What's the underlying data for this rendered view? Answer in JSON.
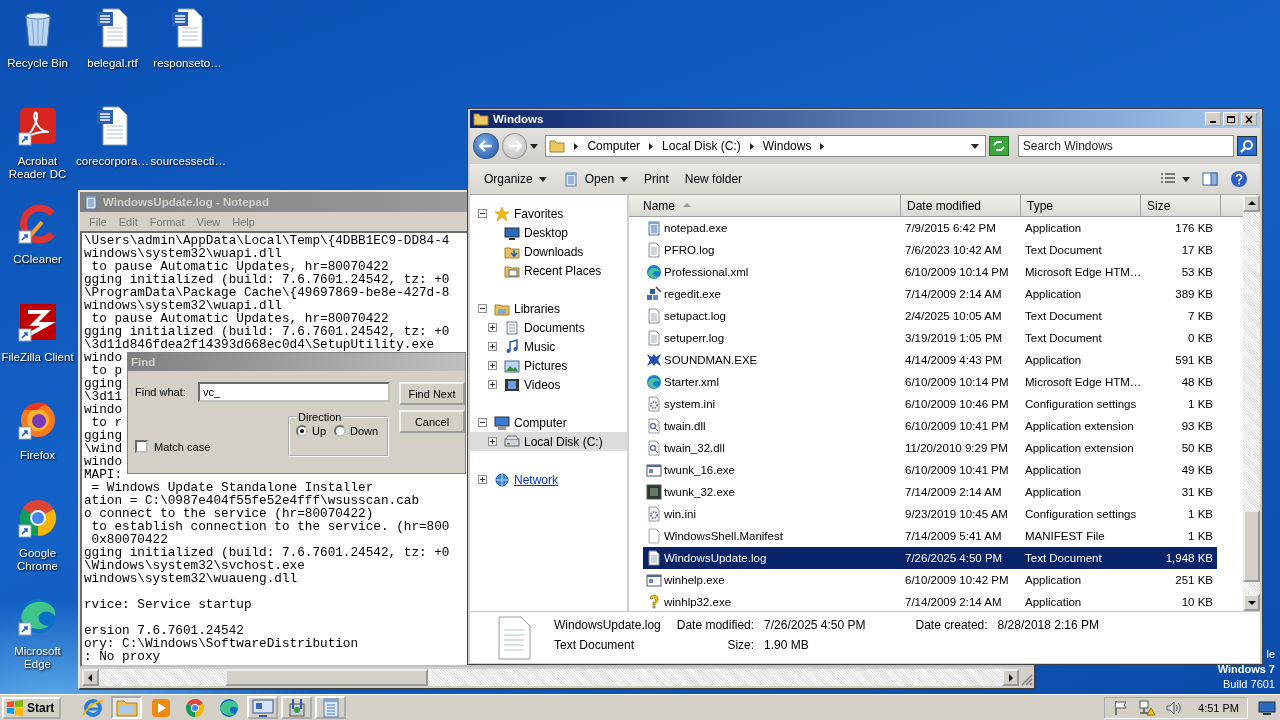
{
  "desktop": {
    "columns": [
      [
        {
          "label": "Recycle Bin",
          "kind": "recycle"
        },
        {
          "label": "Acrobat Reader DC",
          "kind": "pdf",
          "shortcut": true
        },
        {
          "label": "CCleaner",
          "kind": "cleaner",
          "shortcut": true
        },
        {
          "label": "FileZilla Client",
          "kind": "ftp",
          "shortcut": true
        },
        {
          "label": "Firefox",
          "kind": "firefox",
          "shortcut": true
        },
        {
          "label": "Google Chrome",
          "kind": "chrome",
          "shortcut": true
        },
        {
          "label": "Microsoft Edge",
          "kind": "edge",
          "shortcut": true
        }
      ],
      [
        {
          "label": "belegal.rtf",
          "kind": "word"
        },
        {
          "label": "corecorpora…",
          "kind": "word"
        }
      ],
      [
        {
          "label": "responseto…",
          "kind": "word"
        },
        {
          "label": "sourcessecti…",
          "kind": "blank"
        }
      ]
    ],
    "notice": [
      {
        "text": "le",
        "emphasis": false
      },
      {
        "text": "Windows 7",
        "emphasis": true
      },
      {
        "text": "Build 7601",
        "emphasis": false
      }
    ]
  },
  "notepad": {
    "title": "WindowsUpdate.log - Notepad",
    "active": false,
    "menu": [
      "File",
      "Edit",
      "Format",
      "View",
      "Help"
    ],
    "blocks": [
      [
        "\\Users\\admin\\AppData\\Local\\Temp\\{4DBB1EC9-DD84-4",
        "windows\\system32\\wuapi.dll",
        " to pause Automatic Updates, hr=80070422",
        "gging initialized (build: 7.6.7601.24542, tz: +0",
        "\\ProgramData\\Package Cache\\{49697869-be8e-427d-8",
        "windows\\system32\\wuapi.dll",
        " to pause Automatic Updates, hr=80070422",
        "gging initialized (build: 7.6.7601.24542, tz: +0",
        "\\3d11d846fdea2f14393d668ec0d4\\SetupUtility.exe",
        "windo",
        " to p",
        "gging",
        "\\3d11",
        "windo",
        " to r",
        "gging",
        "\\wind",
        "windo",
        "MAPI:",
        " = Windows Update Standalone Installer",
        "ation = C:\\0987e404f55fe52e4fff\\wsusscan.cab",
        "o connect to the service (hr=80070422)",
        " to establish connection to the service. (hr=800",
        " 0x80070422",
        "gging initialized (build: 7.6.7601.24542, tz: +0",
        "\\Windows\\system32\\svchost.exe",
        "windows\\system32\\wuaueng.dll"
      ],
      [
        "rvice: Service startup"
      ],
      [
        "ersion 7.6.7601.24542",
        "ory: C:\\Windows\\SoftwareDistribution",
        ": No proxy"
      ]
    ]
  },
  "find_dialog": {
    "title": "Find",
    "find_what_label": "Find what:",
    "find_what_value": "vc_",
    "match_case": {
      "label": "Match case",
      "checked": false
    },
    "direction": {
      "label": "Direction",
      "options": [
        {
          "label": "Up",
          "selected": true
        },
        {
          "label": "Down",
          "selected": false
        }
      ]
    },
    "buttons": [
      "Find Next",
      "Cancel"
    ]
  },
  "explorer": {
    "title": "Windows",
    "active": true,
    "breadcrumb": [
      "Computer",
      "Local Disk (C:)",
      "Windows"
    ],
    "search": {
      "placeholder": "Search Windows"
    },
    "toolbar": [
      {
        "label": "Organize",
        "kind": "plain",
        "dropdown": true
      },
      {
        "label": "Open",
        "kind": "open",
        "dropdown": true
      },
      {
        "label": "Print",
        "kind": "plain",
        "dropdown": false
      },
      {
        "label": "New folder",
        "kind": "plain",
        "dropdown": false
      }
    ],
    "nav": [
      {
        "label": "Favorites",
        "kind": "star",
        "expanded": true,
        "selected": false,
        "hovered": false,
        "children": [
          {
            "label": "Desktop",
            "kind": "desktop",
            "selected": false
          },
          {
            "label": "Downloads",
            "kind": "downloads",
            "selected": false
          },
          {
            "label": "Recent Places",
            "kind": "recent",
            "selected": false
          }
        ]
      },
      {
        "label": "Libraries",
        "kind": "library",
        "expanded": true,
        "selected": false,
        "hovered": false,
        "children": [
          {
            "label": "Documents",
            "kind": "documents",
            "expanded": false,
            "selected": false
          },
          {
            "label": "Music",
            "kind": "music",
            "expanded": false,
            "selected": false
          },
          {
            "label": "Pictures",
            "kind": "pictures",
            "expanded": false,
            "selected": false
          },
          {
            "label": "Videos",
            "kind": "videos",
            "expanded": false,
            "selected": false
          }
        ]
      },
      {
        "label": "Computer",
        "kind": "computer",
        "expanded": true,
        "selected": false,
        "hovered": false,
        "children": [
          {
            "label": "Local Disk (C:)",
            "kind": "disk",
            "expanded": false,
            "selected": true
          }
        ]
      },
      {
        "label": "Network",
        "kind": "network",
        "expanded": false,
        "selected": false,
        "hovered": true
      }
    ],
    "columns": [
      {
        "label": "Name",
        "sorted": true
      },
      {
        "label": "Date modified",
        "sorted": false
      },
      {
        "label": "Type",
        "sorted": false
      },
      {
        "label": "Size",
        "sorted": false
      }
    ],
    "rows": [
      {
        "name": "notepad.exe",
        "modified": "7/9/2015 6:42 PM",
        "type": "Application",
        "size": "176 KB",
        "kind": "notepad",
        "selected": false
      },
      {
        "name": "PFRO.log",
        "modified": "7/6/2023 10:42 AM",
        "type": "Text Document",
        "size": "17 KB",
        "kind": "text",
        "selected": false
      },
      {
        "name": "Professional.xml",
        "modified": "6/10/2009 10:14 PM",
        "type": "Microsoft Edge HTM…",
        "size": "53 KB",
        "kind": "edge",
        "selected": false
      },
      {
        "name": "regedit.exe",
        "modified": "7/14/2009 2:14 AM",
        "type": "Application",
        "size": "389 KB",
        "kind": "registry",
        "selected": false
      },
      {
        "name": "setupact.log",
        "modified": "2/4/2025 10:05 AM",
        "type": "Text Document",
        "size": "7 KB",
        "kind": "text",
        "selected": false
      },
      {
        "name": "setuperr.log",
        "modified": "3/19/2019 1:05 PM",
        "type": "Text Document",
        "size": "0 KB",
        "kind": "text",
        "selected": false
      },
      {
        "name": "SOUNDMAN.EXE",
        "modified": "4/14/2009 4:43 PM",
        "type": "Application",
        "size": "591 KB",
        "kind": "sound",
        "selected": false
      },
      {
        "name": "Starter.xml",
        "modified": "6/10/2009 10:14 PM",
        "type": "Microsoft Edge HTM…",
        "size": "48 KB",
        "kind": "edge",
        "selected": false
      },
      {
        "name": "system.ini",
        "modified": "6/10/2009 10:46 PM",
        "type": "Configuration settings",
        "size": "1 KB",
        "kind": "settings",
        "selected": false
      },
      {
        "name": "twain.dll",
        "modified": "6/10/2009 10:41 PM",
        "type": "Application extension",
        "size": "93 KB",
        "kind": "extension",
        "selected": false
      },
      {
        "name": "twain_32.dll",
        "modified": "11/20/2010 9:29 PM",
        "type": "Application extension",
        "size": "50 KB",
        "kind": "extension",
        "selected": false
      },
      {
        "name": "twunk_16.exe",
        "modified": "6/10/2009 10:41 PM",
        "type": "Application",
        "size": "49 KB",
        "kind": "app",
        "selected": false
      },
      {
        "name": "twunk_32.exe",
        "modified": "7/14/2009 2:14 AM",
        "type": "Application",
        "size": "31 KB",
        "kind": "terminal",
        "selected": false
      },
      {
        "name": "win.ini",
        "modified": "9/23/2019 10:45 AM",
        "type": "Configuration settings",
        "size": "1 KB",
        "kind": "settings",
        "selected": false
      },
      {
        "name": "WindowsShell.Manifest",
        "modified": "7/14/2009 5:41 AM",
        "type": "MANIFEST File",
        "size": "1 KB",
        "kind": "manifest",
        "selected": false
      },
      {
        "name": "WindowsUpdate.log",
        "modified": "7/26/2025 4:50 PM",
        "type": "Text Document",
        "size": "1,948 KB",
        "kind": "text",
        "selected": true
      },
      {
        "name": "winhelp.exe",
        "modified": "6/10/2009 10:42 PM",
        "type": "Application",
        "size": "251 KB",
        "kind": "app",
        "selected": false
      },
      {
        "name": "winhlp32.exe",
        "modified": "7/14/2009 2:14 AM",
        "type": "Application",
        "size": "10 KB",
        "kind": "help",
        "selected": false
      }
    ],
    "details": {
      "name": "WindowsUpdate.log",
      "type": "Text Document",
      "properties": [
        {
          "label": "Date modified:",
          "value": "7/26/2025 4:50 PM"
        },
        {
          "label": "Size:",
          "value": "1.90 MB"
        },
        {
          "label": "Date created:",
          "value": "8/28/2018 2:16 PM"
        }
      ]
    }
  },
  "taskbar": {
    "start_label": "Start",
    "items": [
      {
        "kind": "ie",
        "running": false,
        "selected": false
      },
      {
        "kind": "folder",
        "running": true,
        "selected": true
      },
      {
        "kind": "media",
        "running": false,
        "selected": false
      },
      {
        "kind": "chrome",
        "running": false,
        "selected": false
      },
      {
        "kind": "edge",
        "running": false,
        "selected": false
      },
      {
        "kind": "monitor",
        "running": true,
        "selected": false
      },
      {
        "kind": "tool",
        "running": true,
        "selected": false
      },
      {
        "kind": "notepad",
        "running": true,
        "selected": false
      }
    ],
    "time": "4:51 PM"
  }
}
